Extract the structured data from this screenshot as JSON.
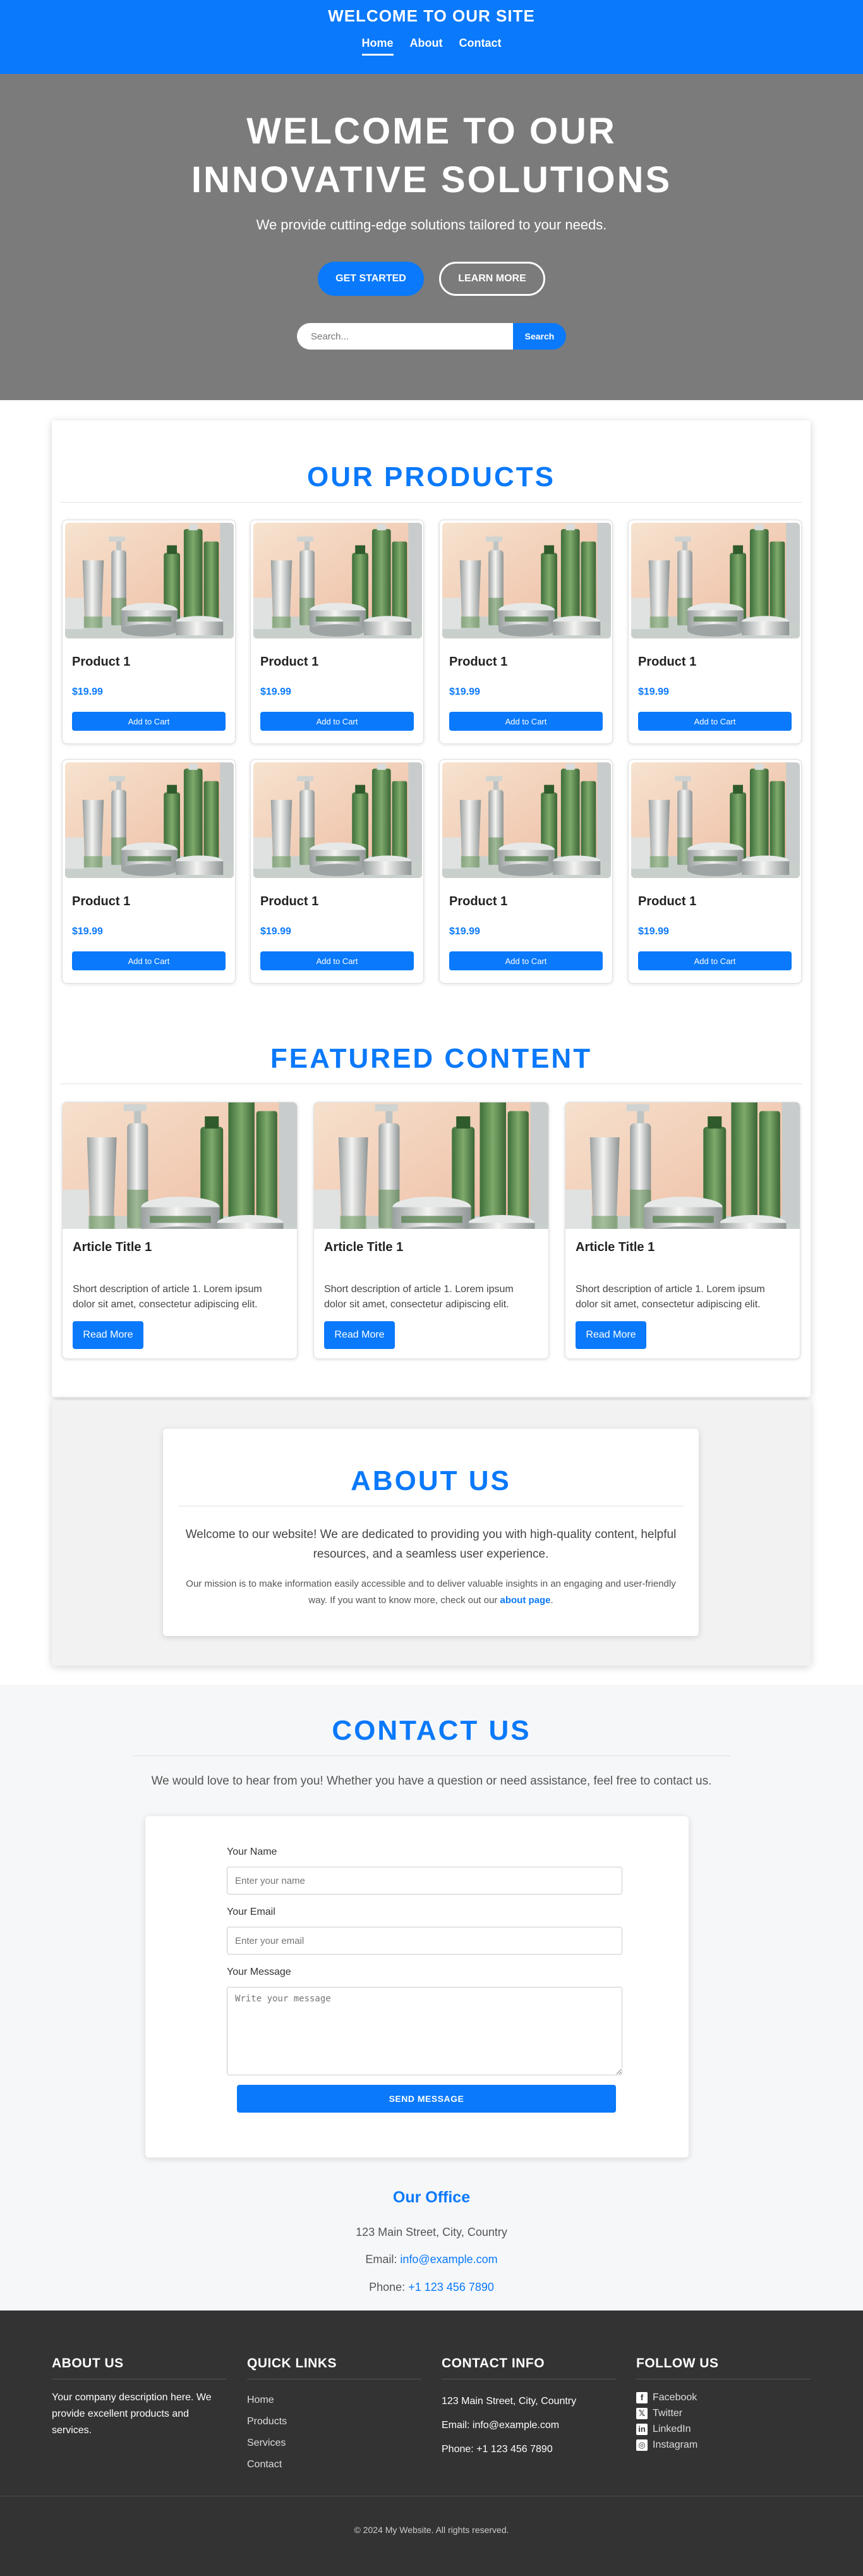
{
  "header": {
    "site_title": "WELCOME TO OUR SITE",
    "nav": [
      {
        "label": "Home"
      },
      {
        "label": "About"
      },
      {
        "label": "Contact"
      }
    ]
  },
  "hero": {
    "title": "WELCOME TO OUR INNOVATIVE SOLUTIONS",
    "subtitle": "We provide cutting-edge solutions tailored to your needs.",
    "primary_button": "GET STARTED",
    "secondary_button": "LEARN MORE",
    "search_placeholder": "Search...",
    "search_button": "Search"
  },
  "products": {
    "title": "OUR PRODUCTS",
    "items": [
      {
        "name": "Product 1",
        "price": "$19.99",
        "button": "Add to Cart"
      },
      {
        "name": "Product 1",
        "price": "$19.99",
        "button": "Add to Cart"
      },
      {
        "name": "Product 1",
        "price": "$19.99",
        "button": "Add to Cart"
      },
      {
        "name": "Product 1",
        "price": "$19.99",
        "button": "Add to Cart"
      },
      {
        "name": "Product 1",
        "price": "$19.99",
        "button": "Add to Cart"
      },
      {
        "name": "Product 1",
        "price": "$19.99",
        "button": "Add to Cart"
      },
      {
        "name": "Product 1",
        "price": "$19.99",
        "button": "Add to Cart"
      },
      {
        "name": "Product 1",
        "price": "$19.99",
        "button": "Add to Cart"
      }
    ]
  },
  "featured": {
    "title": "FEATURED CONTENT",
    "articles": [
      {
        "title": "Article Title 1",
        "text": "Short description of article 1. Lorem ipsum dolor sit amet, consectetur adipiscing elit.",
        "button": "Read More"
      },
      {
        "title": "Article Title 1",
        "text": "Short description of article 1. Lorem ipsum dolor sit amet, consectetur adipiscing elit.",
        "button": "Read More"
      },
      {
        "title": "Article Title 1",
        "text": "Short description of article 1. Lorem ipsum dolor sit amet, consectetur adipiscing elit.",
        "button": "Read More"
      }
    ]
  },
  "about": {
    "title": "ABOUT US",
    "lead": "Welcome to our website! We are dedicated to providing you with high-quality content, helpful resources, and a seamless user experience.",
    "mission": "Our mission is to make information easily accessible and to deliver valuable insights in an engaging and user-friendly way. If you want to know more, check out our",
    "mission_link": "about page",
    "mission_end": "."
  },
  "contact": {
    "title": "CONTACT US",
    "intro": "We would love to hear from you! Whether you have a question or need assistance, feel free to contact us.",
    "name_label": "Your Name",
    "name_placeholder": "Enter your name",
    "email_label": "Your Email",
    "email_placeholder": "Enter your email",
    "message_label": "Your Message",
    "message_placeholder": "Write your message",
    "send_button": "SEND MESSAGE",
    "office": {
      "title": "Our Office",
      "address": "123 Main Street, City, Country",
      "email_label": "Email:",
      "email": "info@example.com",
      "phone_label": "Phone:",
      "phone": "+1 123 456 7890"
    }
  },
  "footer": {
    "about_title": "ABOUT US",
    "about_text": "Your company description here. We provide excellent products and services.",
    "links_title": "QUICK LINKS",
    "links": [
      "Home",
      "Products",
      "Services",
      "Contact"
    ],
    "contact_title": "CONTACT INFO",
    "contact_lines": [
      "123 Main Street, City, Country",
      "Email: info@example.com",
      "Phone: +1 123 456 7890"
    ],
    "follow_title": "FOLLOW US",
    "social": [
      {
        "label": "Facebook",
        "icon": "facebook-icon",
        "glyph": "f"
      },
      {
        "label": "Twitter",
        "icon": "x-twitter-icon",
        "glyph": "𝕏"
      },
      {
        "label": "LinkedIn",
        "icon": "linkedin-icon",
        "glyph": "in"
      },
      {
        "label": "Instagram",
        "icon": "instagram-icon",
        "glyph": "◎"
      }
    ],
    "copyright": "© 2024 My Website. All rights reserved."
  },
  "colors": {
    "accent": "#0a79fb",
    "hero_bg": "#7b7b7b",
    "footer_bg": "#333333"
  }
}
